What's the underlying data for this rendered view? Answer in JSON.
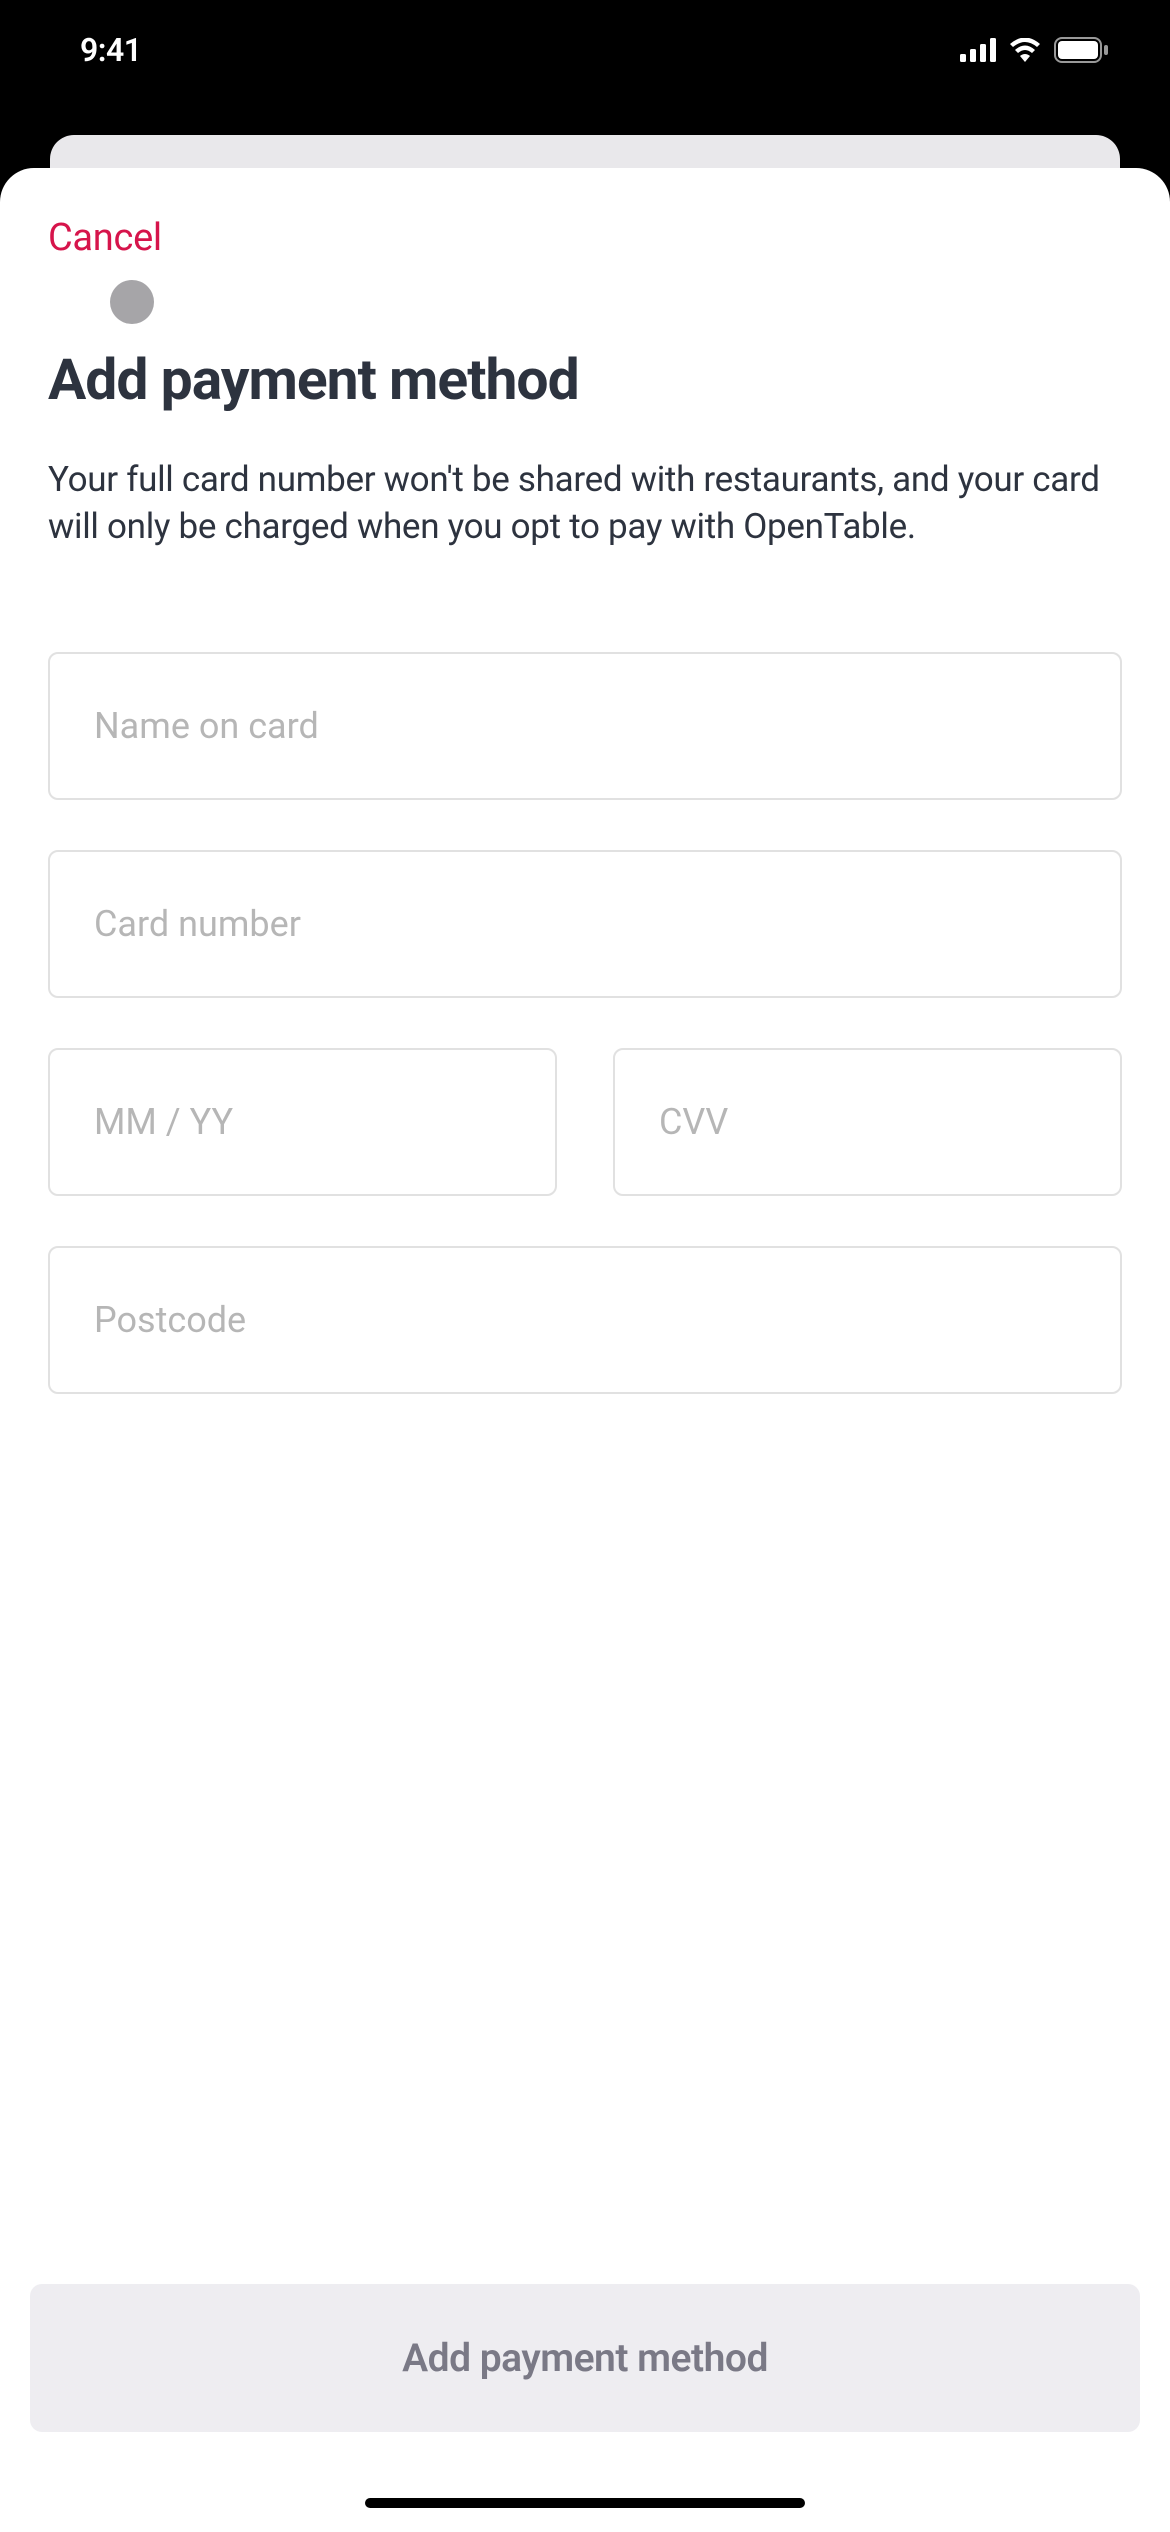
{
  "status": {
    "time": "9:41"
  },
  "sheet": {
    "cancel": "Cancel",
    "title": "Add payment method",
    "description": "Your full card number won't be shared with restaurants, and your card will only be charged when you opt to pay with OpenTable."
  },
  "form": {
    "name_placeholder": "Name on card",
    "card_placeholder": "Card number",
    "expiry_placeholder": "MM / YY",
    "cvv_placeholder": "CVV",
    "postcode_placeholder": "Postcode",
    "submit_label": "Add payment method"
  }
}
